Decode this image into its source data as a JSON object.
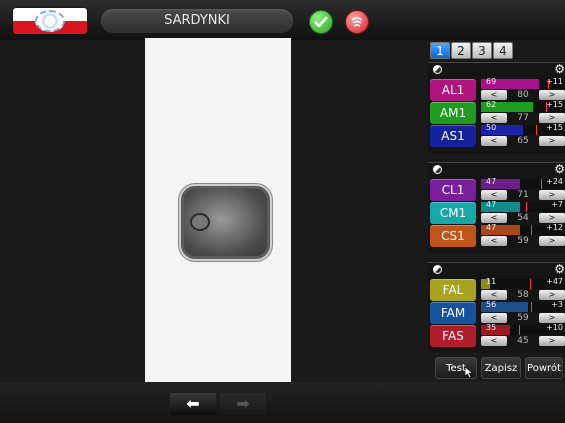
{
  "header": {
    "title": "SARDYNKI",
    "colors": {
      "flag_white": "#ffffff",
      "flag_red": "#d8141f",
      "ok_green": "#2aa52a",
      "cancel_red": "#d42525"
    },
    "icons": {
      "flag": "polish-flag-logo-icon",
      "ok": "checkmark-icon",
      "cancel": "cancel-lamp-icon"
    }
  },
  "tabs": [
    {
      "label": "1",
      "active": true
    },
    {
      "label": "2",
      "active": false
    },
    {
      "label": "3",
      "active": false
    },
    {
      "label": "4",
      "active": false
    }
  ],
  "panels": [
    {
      "rows": [
        {
          "label": "AL1",
          "value": "69",
          "mid": "80",
          "offset": "+11",
          "color": "#b0157f",
          "fill_color": "#a7148a",
          "level": 0.69,
          "marker": 0.8
        },
        {
          "label": "AM1",
          "value": "62",
          "mid": "77",
          "offset": "+15",
          "color": "#1f9c1f",
          "fill_color": "#1f9c1f",
          "level": 0.62,
          "marker": 0.77
        },
        {
          "label": "AS1",
          "value": "50",
          "mid": "65",
          "offset": "+15",
          "color": "#15229c",
          "fill_color": "#1d22a6",
          "level": 0.5,
          "marker": 0.65
        }
      ]
    },
    {
      "rows": [
        {
          "label": "CL1",
          "value": "47",
          "mid": "71",
          "offset": "+24",
          "color": "#7a1f9a",
          "fill_color": "#6a1f8a",
          "level": 0.47,
          "marker": 0.71
        },
        {
          "label": "CM1",
          "value": "47",
          "mid": "54",
          "offset": "+7",
          "color": "#16a8a8",
          "fill_color": "#128a8a",
          "level": 0.47,
          "marker": 0.54
        },
        {
          "label": "CS1",
          "value": "47",
          "mid": "59",
          "offset": "+12",
          "color": "#c0541a",
          "fill_color": "#a8481a",
          "level": 0.47,
          "marker": 0.59
        }
      ]
    },
    {
      "rows": [
        {
          "label": "FAL",
          "value": "11",
          "mid": "58",
          "offset": "+47",
          "color": "#a6a320",
          "fill_color": "#8f8c1a",
          "level": 0.11,
          "marker": 0.58
        },
        {
          "label": "FAM",
          "value": "56",
          "mid": "59",
          "offset": "+3",
          "color": "#15549c",
          "fill_color": "#1d4e8a",
          "level": 0.56,
          "marker": 0.59
        },
        {
          "label": "FAS",
          "value": "35",
          "mid": "45",
          "offset": "+10",
          "color": "#b01d2a",
          "fill_color": "#9c1a25",
          "level": 0.35,
          "marker": 0.45
        }
      ]
    }
  ],
  "step_buttons": {
    "left": "<",
    "right": ">"
  },
  "actions": {
    "test": "Test",
    "save": "Zapisz",
    "back": "Powrót"
  },
  "navigation": {
    "prev": "⬅",
    "next": "➡"
  },
  "panel_icons": {
    "disc": "contrast-icon",
    "gear": "gear-icon"
  }
}
